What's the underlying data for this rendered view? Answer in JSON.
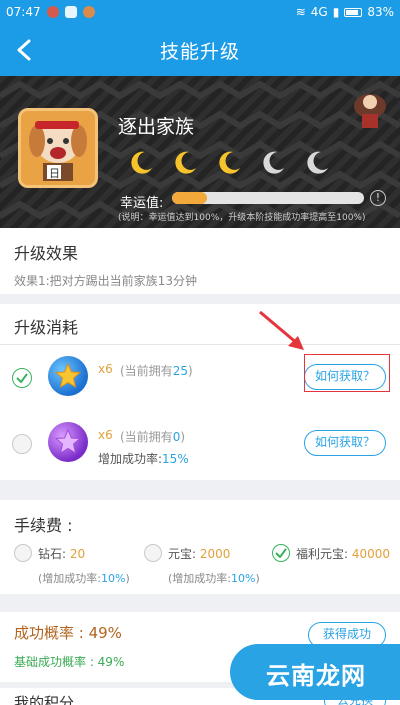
{
  "status_bar": {
    "time": "07:47",
    "network": "4G",
    "battery": "83%"
  },
  "header": {
    "title": "技能升级"
  },
  "skill": {
    "name": "逐出家族",
    "luck_label": "幸运值:",
    "luck_fraction": 0.18,
    "note": "(说明：幸运值达到100%，升级本阶技能成功率提高至100%)",
    "moons": [
      {
        "state": "lit"
      },
      {
        "state": "lit"
      },
      {
        "state": "lit"
      },
      {
        "state": "dim"
      },
      {
        "state": "dim"
      }
    ]
  },
  "upgrade_effect": {
    "title": "升级效果",
    "description": "效果1:把对方踢出当前家族13分钟"
  },
  "upgrade_cost": {
    "title": "升级消耗",
    "items": [
      {
        "icon": "blue-star-orb",
        "qty": "x6",
        "own_prefix": "(当前拥有",
        "own_value": "25",
        "own_suffix": ")",
        "bonus": "",
        "bonus_value": "",
        "how_label": "如何获取？",
        "checked": true
      },
      {
        "icon": "purple-star-orb",
        "qty": "x6",
        "own_prefix": "(当前拥有",
        "own_value": "0",
        "own_suffix": ")",
        "bonus": "增加成功率:",
        "bonus_value": "15%",
        "how_label": "如何获取？",
        "checked": false
      }
    ]
  },
  "fee": {
    "title": "手续费 :",
    "options": [
      {
        "label": "钻石:",
        "value": "20",
        "sub": "(增加成功率:",
        "sub_value": "10%",
        "sub_end": ")",
        "selected": false
      },
      {
        "label": "元宝:",
        "value": "2000",
        "sub": "(增加成功率:",
        "sub_value": "10%",
        "sub_end": ")",
        "selected": false
      },
      {
        "label": "福利元宝:",
        "value": "40000",
        "sub": "",
        "sub_value": "",
        "sub_end": "",
        "selected": true
      }
    ]
  },
  "success": {
    "rate": "成功概率 : 49%",
    "base": "基础成功概率 : 49%",
    "gain_button": "获得成功"
  },
  "points": {
    "title": "我的积分",
    "earn_button": "去兑换"
  },
  "watermark": {
    "text": "云南龙网"
  },
  "colors": {
    "accent": "#1c9be6",
    "highlight_box": "#e3353b"
  }
}
